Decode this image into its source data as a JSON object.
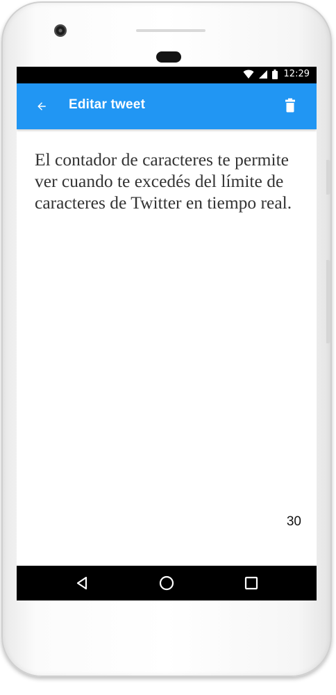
{
  "status_bar": {
    "time": "12:29",
    "icons": [
      "wifi-icon",
      "cell-signal-icon",
      "battery-icon"
    ]
  },
  "app_bar": {
    "title": "Editar tweet",
    "back_icon": "arrow-back-icon",
    "delete_icon": "trash-icon",
    "color": "#2196F3"
  },
  "editor": {
    "text": "El contador de caracteres te permite ver cuando te excedés del límite de caracteres de Twitter en tiempo real."
  },
  "character_counter": {
    "value": "30"
  },
  "nav_bar": {
    "buttons": [
      "back-triangle-icon",
      "home-circle-icon",
      "recents-square-icon"
    ]
  }
}
